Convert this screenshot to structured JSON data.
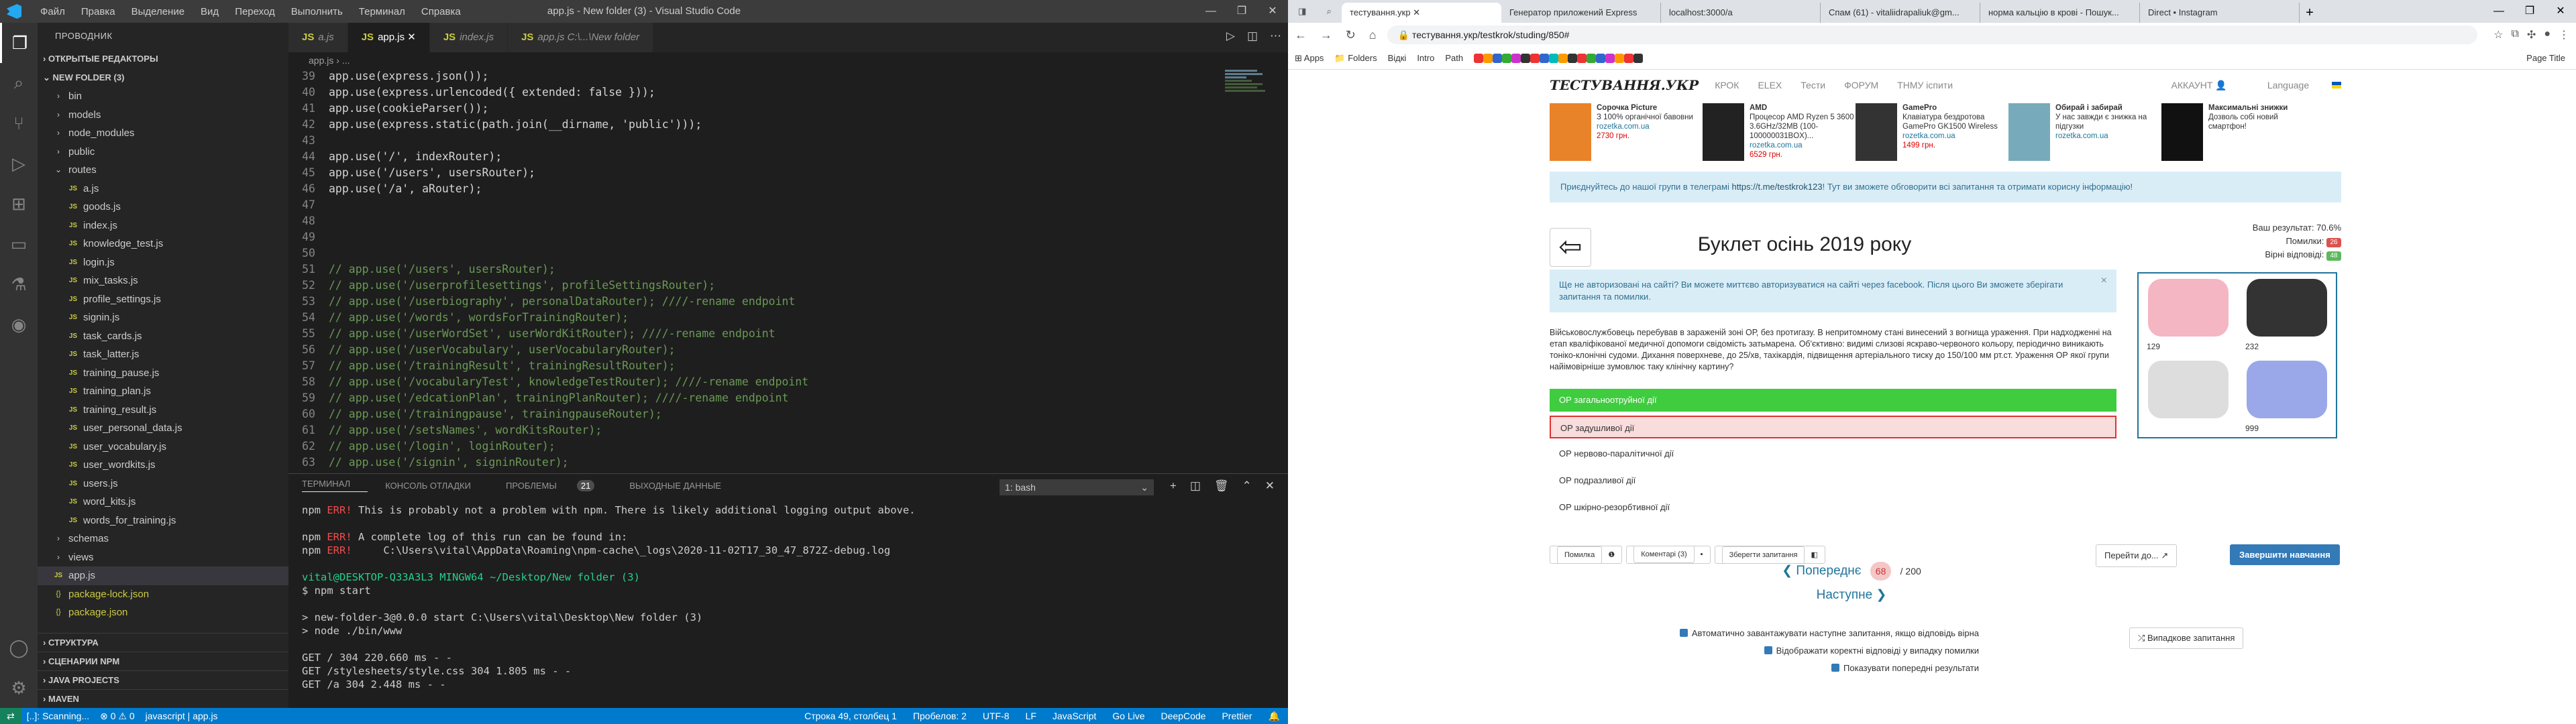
{
  "vscode": {
    "title": "app.js - New folder (3) - Visual Studio Code",
    "menu": [
      "Файл",
      "Правка",
      "Выделение",
      "Вид",
      "Переход",
      "Выполнить",
      "Терминал",
      "Справка"
    ],
    "explorer_header": "ПРОВОДНИК",
    "open_editors": "ОТКРЫТЫЕ РЕДАКТОРЫ",
    "folder": "NEW FOLDER (3)",
    "tree": [
      {
        "label": "bin",
        "type": "folder",
        "depth": 1
      },
      {
        "label": "models",
        "type": "folder",
        "depth": 1
      },
      {
        "label": "node_modules",
        "type": "folder",
        "depth": 1
      },
      {
        "label": "public",
        "type": "folder",
        "depth": 1
      },
      {
        "label": "routes",
        "type": "folder-open",
        "depth": 1
      },
      {
        "label": "a.js",
        "type": "js",
        "depth": 2
      },
      {
        "label": "goods.js",
        "type": "js",
        "depth": 2
      },
      {
        "label": "index.js",
        "type": "js",
        "depth": 2
      },
      {
        "label": "knowledge_test.js",
        "type": "js",
        "depth": 2
      },
      {
        "label": "login.js",
        "type": "js",
        "depth": 2
      },
      {
        "label": "mix_tasks.js",
        "type": "js",
        "depth": 2
      },
      {
        "label": "profile_settings.js",
        "type": "js",
        "depth": 2
      },
      {
        "label": "signin.js",
        "type": "js",
        "depth": 2
      },
      {
        "label": "task_cards.js",
        "type": "js",
        "depth": 2
      },
      {
        "label": "task_latter.js",
        "type": "js",
        "depth": 2
      },
      {
        "label": "training_pause.js",
        "type": "js",
        "depth": 2
      },
      {
        "label": "training_plan.js",
        "type": "js",
        "depth": 2
      },
      {
        "label": "training_result.js",
        "type": "js",
        "depth": 2
      },
      {
        "label": "user_personal_data.js",
        "type": "js",
        "depth": 2
      },
      {
        "label": "user_vocabulary.js",
        "type": "js",
        "depth": 2
      },
      {
        "label": "user_wordkits.js",
        "type": "js",
        "depth": 2
      },
      {
        "label": "users.js",
        "type": "js",
        "depth": 2
      },
      {
        "label": "word_kits.js",
        "type": "js",
        "depth": 2
      },
      {
        "label": "words_for_training.js",
        "type": "js",
        "depth": 2
      },
      {
        "label": "schemas",
        "type": "folder",
        "depth": 1
      },
      {
        "label": "views",
        "type": "folder",
        "depth": 1
      },
      {
        "label": "app.js",
        "type": "js",
        "depth": 1,
        "selected": true
      },
      {
        "label": "package-lock.json",
        "type": "json",
        "depth": 1
      },
      {
        "label": "package.json",
        "type": "json",
        "depth": 1
      }
    ],
    "bottom_sections": [
      "СТРУКТУРА",
      "СЦЕНАРИИ NPM",
      "JAVA PROJECTS",
      "MAVEN"
    ],
    "tabs": [
      {
        "label": "a.js",
        "active": false
      },
      {
        "label": "app.js",
        "active": true
      },
      {
        "label": "index.js",
        "active": false
      },
      {
        "label": "app.js  C:\\...\\New folder",
        "active": false
      }
    ],
    "breadcrumb": "app.js › ...",
    "code": [
      {
        "n": "39",
        "t": "app.use(express.json());",
        "c": false
      },
      {
        "n": "40",
        "t": "app.use(express.urlencoded({ extended: false }));",
        "c": false
      },
      {
        "n": "41",
        "t": "app.use(cookieParser());",
        "c": false
      },
      {
        "n": "42",
        "t": "app.use(express.static(path.join(__dirname, 'public')));",
        "c": false
      },
      {
        "n": "43",
        "t": "",
        "c": false
      },
      {
        "n": "44",
        "t": "app.use('/', indexRouter);",
        "c": false
      },
      {
        "n": "45",
        "t": "app.use('/users', usersRouter);",
        "c": false
      },
      {
        "n": "46",
        "t": "app.use('/a', aRouter);",
        "c": false
      },
      {
        "n": "47",
        "t": "",
        "c": false
      },
      {
        "n": "48",
        "t": "",
        "c": false
      },
      {
        "n": "49",
        "t": "",
        "c": false
      },
      {
        "n": "50",
        "t": "",
        "c": false
      },
      {
        "n": "51",
        "t": "// app.use('/users', usersRouter);",
        "c": true
      },
      {
        "n": "52",
        "t": "// app.use('/userprofilesettings', profileSettingsRouter);",
        "c": true
      },
      {
        "n": "53",
        "t": "// app.use('/userbiography', personalDataRouter); ////-rename endpoint",
        "c": true
      },
      {
        "n": "54",
        "t": "// app.use('/words', wordsForTrainingRouter);",
        "c": true
      },
      {
        "n": "55",
        "t": "// app.use('/userWordSet', userWordKitRouter); ////-rename endpoint",
        "c": true
      },
      {
        "n": "56",
        "t": "// app.use('/userVocabulary', userVocabularyRouter);",
        "c": true
      },
      {
        "n": "57",
        "t": "// app.use('/trainingResult', trainingResultRouter);",
        "c": true
      },
      {
        "n": "58",
        "t": "// app.use('/vocabularyTest', knowledgeTestRouter); ////-rename endpoint",
        "c": true
      },
      {
        "n": "59",
        "t": "// app.use('/edcationPlan', trainingPlanRouter); ////-rename endpoint",
        "c": true
      },
      {
        "n": "60",
        "t": "// app.use('/trainingpause', trainingpauseRouter);",
        "c": true
      },
      {
        "n": "61",
        "t": "// app.use('/setsNames', wordKitsRouter);",
        "c": true
      },
      {
        "n": "62",
        "t": "// app.use('/login', loginRouter);",
        "c": true
      },
      {
        "n": "63",
        "t": "// app.use('/signin', signinRouter);",
        "c": true
      }
    ],
    "panel_tabs": [
      {
        "label": "ТЕРМИНАЛ",
        "active": true
      },
      {
        "label": "КОНСОЛЬ ОТЛАДКИ",
        "active": false
      },
      {
        "label": "ПРОБЛЕМЫ",
        "active": false,
        "badge": "21"
      },
      {
        "label": "ВЫХОДНЫЕ ДАННЫЕ",
        "active": false
      }
    ],
    "shell": "1: bash",
    "terminal": [
      "npm ERR! This is probably not a problem with npm. There is likely additional logging output above.",
      "",
      "npm ERR! A complete log of this run can be found in:",
      "npm ERR!     C:\\Users\\vital\\AppData\\Roaming\\npm-cache\\_logs\\2020-11-02T17_30_47_872Z-debug.log",
      "",
      "vital@DESKTOP-Q33A3L3 MINGW64 ~/Desktop/New folder (3)",
      "$ npm start",
      "",
      "> new-folder-3@0.0.0 start C:\\Users\\vital\\Desktop\\New folder (3)",
      "> node ./bin/www",
      "",
      "GET / 304 220.660 ms - -",
      "GET /stylesheets/style.css 304 1.805 ms - -",
      "GET /a 304 2.448 ms - -"
    ],
    "status_left": [
      "[..]: Scanning...",
      "⊗ 0 ⚠ 0",
      "javascript | app.js"
    ],
    "status_right": [
      "Строка 49, столбец 1",
      "Пробелов: 2",
      "UTF-8",
      "LF",
      "JavaScript",
      "Go Live",
      "DeepCode",
      "Prettier"
    ]
  },
  "chrome": {
    "tabs": [
      {
        "label": "Генератор приложений Express",
        "active": false
      },
      {
        "label": "localhost:3000/a",
        "active": false
      },
      {
        "label": "Спам (61) - vitaliidrapaliuk@gm...",
        "active": false
      },
      {
        "label": "норма кальцію в крові - Пошук...",
        "active": false
      },
      {
        "label": "Direct • Instagram",
        "active": false
      }
    ],
    "url": "тестування.укр/testkrok/studing/850#",
    "bookmarks": [
      "Apps",
      "Folders",
      "Відкі",
      "Intro",
      "Path",
      "Page Title"
    ],
    "site": {
      "logo": "ТЕСТУВАННЯ.УКР",
      "nav": [
        "КРОК",
        "ELEX",
        "Тести",
        "ФОРУМ",
        "ТНМУ іспити"
      ],
      "account": "АККАУНТ",
      "language": "Language",
      "ads": [
        {
          "title": "Сорочка Picture",
          "desc": "З 100% органічної бавовни",
          "link": "rozetka.com.ua",
          "price": "2730 грн."
        },
        {
          "title": "AMD",
          "desc": "Процесор AMD Ryzen 5 3600 3.6GHz/32MB (100-100000031BOX)...",
          "link": "rozetka.com.ua",
          "price": "6529 грн."
        },
        {
          "title": "GamePro",
          "desc": "Клавіатура бездротова GamePro GK1500 Wireless",
          "link": "rozetka.com.ua",
          "price": "1499 грн."
        },
        {
          "title": "Обирай і забирай",
          "desc": "У нас завжди є знижка на підгузки",
          "link": "rozetka.com.ua",
          "price": ""
        },
        {
          "title": "Максимальні знижки",
          "desc": "Дозволь собі новий смартфон!",
          "link": "",
          "price": ""
        }
      ],
      "telegram_text": "Приєднуйтесь до нашої групи в телеграмі",
      "telegram_link": "https://t.me/testkrok123",
      "telegram_rest": "! Тут ви зможете обговорити всі запитання та отримати корисну інформацію!",
      "result_label": "Ваш результат: 70.6%",
      "errors_label": "Помилки:",
      "errors": "26",
      "correct_label": "Вірні відповіді:",
      "correct": "48",
      "title": "Буклет осінь 2019 року",
      "auth_alert": "Ще не авторизовані на сайті? Ви можете миттєво авторизуватися на сайті через facebook. Після цього Ви зможете зберігати запитання та помилки.",
      "question": "Військовослужбовець перебував в зараженій зоні ОР, без протигазу. В непритомному стані винесений з вогнища ураження. При надходженні на етап кваліфікованої медичної допомоги свідомість затьмарена. Об'єктивно: видимі слизові яскраво-червоного кольору, періодично виникають тоніко-клонічні судоми. Дихання поверхневе, до 25/хв, тахікардія, підвищення артеріального тиску до 150/100 мм рт.ст. Ураження ОР якої групи найімовірніше зумовлює таку клінічну картину?",
      "answers": [
        {
          "label": "ОР загальноотруйної дії",
          "state": "correct"
        },
        {
          "label": "ОР задушливої дії",
          "state": "wrong"
        },
        {
          "label": "ОР нервово-паралітичної дії",
          "state": "none"
        },
        {
          "label": "ОР подразливої дії",
          "state": "none"
        },
        {
          "label": "ОР шкірно-резорбтивної дії",
          "state": "none"
        }
      ],
      "products": [
        {
          "price": "129",
          "color": "#f4b6c2"
        },
        {
          "price": "232",
          "color": "#333333"
        },
        {
          "price": "",
          "color": "#dddddd"
        },
        {
          "price": "999",
          "color": "#9aa7e8"
        }
      ],
      "tools": [
        "Помилка",
        "Коментарі (3)",
        "Зберегти запитання"
      ],
      "goto": "Перейти до...",
      "finish": "Завершити навчання",
      "prev": "Попереднє",
      "page": "68",
      "of": "/ 200",
      "next": "Наступне",
      "options": [
        "Автоматично завантажувати наступне запитання, якщо відповідь вірна",
        "Відображати коректні відповіді у випадку помилки",
        "Показувати попередні результати"
      ],
      "random": "Випадкове запитання"
    }
  }
}
